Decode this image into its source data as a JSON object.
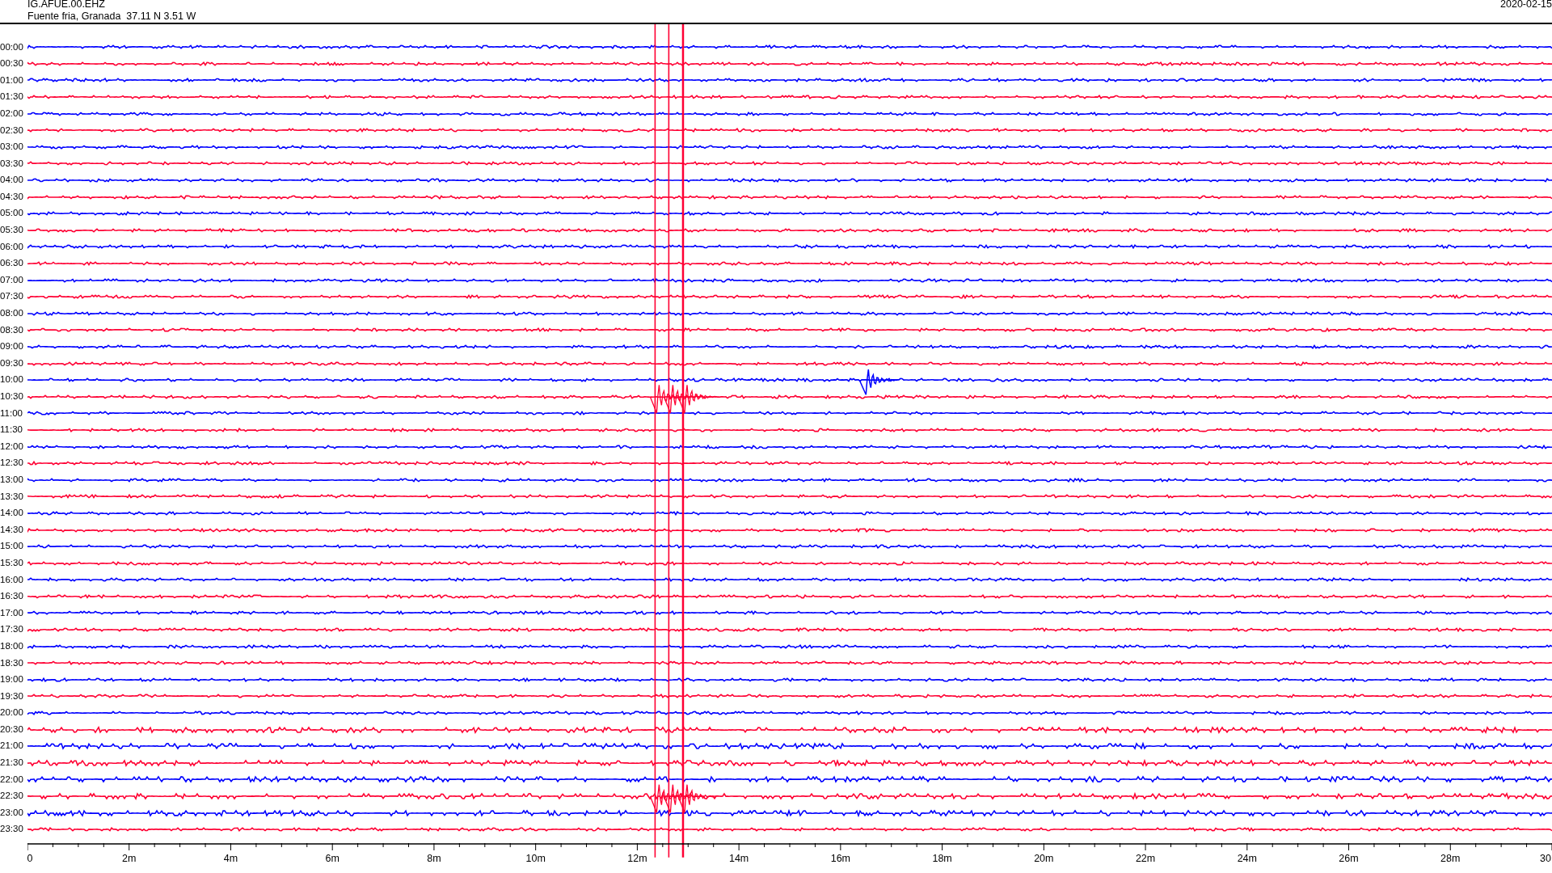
{
  "header": {
    "station": "IG.AFUE.00.EHZ",
    "location": "Fuente fria, Granada  37.11 N 3.51 W",
    "date": "2020-02-15"
  },
  "rows": [
    {
      "label": "00:00",
      "color": "#0000ff"
    },
    {
      "label": "00:30",
      "color": "#ff0033"
    },
    {
      "label": "01:00",
      "color": "#0000ff"
    },
    {
      "label": "01:30",
      "color": "#ff0033"
    },
    {
      "label": "02:00",
      "color": "#0000ff"
    },
    {
      "label": "02:30",
      "color": "#ff0033"
    },
    {
      "label": "03:00",
      "color": "#0000ff"
    },
    {
      "label": "03:30",
      "color": "#ff0033"
    },
    {
      "label": "04:00",
      "color": "#0000ff"
    },
    {
      "label": "04:30",
      "color": "#ff0033"
    },
    {
      "label": "05:00",
      "color": "#0000ff"
    },
    {
      "label": "05:30",
      "color": "#ff0033"
    },
    {
      "label": "06:00",
      "color": "#0000ff"
    },
    {
      "label": "06:30",
      "color": "#ff0033"
    },
    {
      "label": "07:00",
      "color": "#0000ff"
    },
    {
      "label": "07:30",
      "color": "#ff0033"
    },
    {
      "label": "08:00",
      "color": "#0000ff"
    },
    {
      "label": "08:30",
      "color": "#ff0033"
    },
    {
      "label": "09:00",
      "color": "#0000ff"
    },
    {
      "label": "09:30",
      "color": "#ff0033"
    },
    {
      "label": "10:00",
      "color": "#0000ff"
    },
    {
      "label": "10:30",
      "color": "#ff0033"
    },
    {
      "label": "11:00",
      "color": "#0000ff"
    },
    {
      "label": "11:30",
      "color": "#ff0033"
    },
    {
      "label": "12:00",
      "color": "#0000ff"
    },
    {
      "label": "12:30",
      "color": "#ff0033"
    },
    {
      "label": "13:00",
      "color": "#0000ff"
    },
    {
      "label": "13:30",
      "color": "#ff0033"
    },
    {
      "label": "14:00",
      "color": "#0000ff"
    },
    {
      "label": "14:30",
      "color": "#ff0033"
    },
    {
      "label": "15:00",
      "color": "#0000ff"
    },
    {
      "label": "15:30",
      "color": "#ff0033"
    },
    {
      "label": "16:00",
      "color": "#0000ff"
    },
    {
      "label": "16:30",
      "color": "#ff0033"
    },
    {
      "label": "17:00",
      "color": "#0000ff"
    },
    {
      "label": "17:30",
      "color": "#ff0033"
    },
    {
      "label": "18:00",
      "color": "#0000ff"
    },
    {
      "label": "18:30",
      "color": "#ff0033"
    },
    {
      "label": "19:00",
      "color": "#0000ff"
    },
    {
      "label": "19:30",
      "color": "#ff0033"
    },
    {
      "label": "20:00",
      "color": "#0000ff"
    },
    {
      "label": "20:30",
      "color": "#ff0033"
    },
    {
      "label": "21:00",
      "color": "#0000ff"
    },
    {
      "label": "21:30",
      "color": "#ff0033"
    },
    {
      "label": "22:00",
      "color": "#0000ff"
    },
    {
      "label": "22:30",
      "color": "#ff0033"
    },
    {
      "label": "23:00",
      "color": "#0000ff"
    },
    {
      "label": "23:30",
      "color": "#ff0033"
    }
  ],
  "axis_labels": [
    "0",
    "2m",
    "4m",
    "6m",
    "8m",
    "10m",
    "12m",
    "14m",
    "16m",
    "18m",
    "20m",
    "22m",
    "24m",
    "26m",
    "28m",
    "30"
  ]
}
